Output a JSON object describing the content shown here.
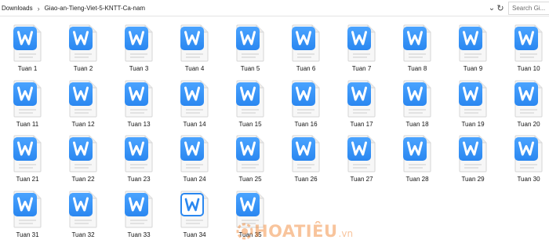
{
  "address": {
    "crumbs": [
      "Downloads",
      "Giao-an-Tieng-Viet-5-KNTT-Ca-nam"
    ],
    "chevron_glyph": "⌄",
    "refresh_glyph": "↻",
    "search_placeholder": "Search Gi..."
  },
  "files": [
    {
      "name": "Tuan 1",
      "icon": "wps-writer-doc-icon"
    },
    {
      "name": "Tuan 2",
      "icon": "wps-writer-doc-icon"
    },
    {
      "name": "Tuan 3",
      "icon": "wps-writer-doc-icon"
    },
    {
      "name": "Tuan 4",
      "icon": "wps-writer-doc-icon"
    },
    {
      "name": "Tuan 5",
      "icon": "wps-writer-doc-icon"
    },
    {
      "name": "Tuan 6",
      "icon": "wps-writer-doc-icon"
    },
    {
      "name": "Tuan 7",
      "icon": "wps-writer-doc-icon"
    },
    {
      "name": "Tuan 8",
      "icon": "wps-writer-doc-icon"
    },
    {
      "name": "Tuan 9",
      "icon": "wps-writer-doc-icon"
    },
    {
      "name": "Tuan 10",
      "icon": "wps-writer-doc-icon"
    },
    {
      "name": "Tuan 11",
      "icon": "wps-writer-doc-icon"
    },
    {
      "name": "Tuan 12",
      "icon": "wps-writer-doc-icon"
    },
    {
      "name": "Tuan 13",
      "icon": "wps-writer-doc-icon"
    },
    {
      "name": "Tuan 14",
      "icon": "wps-writer-doc-icon"
    },
    {
      "name": "Tuan 15",
      "icon": "wps-writer-doc-icon"
    },
    {
      "name": "Tuan 16",
      "icon": "wps-writer-doc-icon"
    },
    {
      "name": "Tuan 17",
      "icon": "wps-writer-doc-icon"
    },
    {
      "name": "Tuan 18",
      "icon": "wps-writer-doc-icon"
    },
    {
      "name": "Tuan 19",
      "icon": "wps-writer-doc-icon"
    },
    {
      "name": "Tuan 20",
      "icon": "wps-writer-doc-icon"
    },
    {
      "name": "Tuan 21",
      "icon": "wps-writer-doc-icon"
    },
    {
      "name": "Tuan 22",
      "icon": "wps-writer-doc-icon"
    },
    {
      "name": "Tuan 23",
      "icon": "wps-writer-doc-icon"
    },
    {
      "name": "Tuan 24",
      "icon": "wps-writer-doc-icon"
    },
    {
      "name": "Tuan 25",
      "icon": "wps-writer-doc-icon"
    },
    {
      "name": "Tuan 26",
      "icon": "wps-writer-doc-icon"
    },
    {
      "name": "Tuan 27",
      "icon": "wps-writer-doc-icon"
    },
    {
      "name": "Tuan 28",
      "icon": "wps-writer-doc-icon"
    },
    {
      "name": "Tuan 29",
      "icon": "wps-writer-doc-icon"
    },
    {
      "name": "Tuan 30",
      "icon": "wps-writer-doc-icon"
    },
    {
      "name": "Tuan 31",
      "icon": "wps-writer-doc-icon"
    },
    {
      "name": "Tuan 32",
      "icon": "wps-writer-doc-icon"
    },
    {
      "name": "Tuan 33",
      "icon": "wps-writer-doc-icon"
    },
    {
      "name": "Tuan 34",
      "icon": "wps-writer-doc-outline-icon"
    },
    {
      "name": "Tuan 35",
      "icon": "wps-writer-doc-icon"
    }
  ],
  "watermark": {
    "text": "HOATIÊU",
    "suffix": ".vn"
  },
  "colors": {
    "icon_blue": "#2a87f0",
    "icon_blue_light": "#4aa3ff",
    "watermark_orange": "#f07e26"
  }
}
